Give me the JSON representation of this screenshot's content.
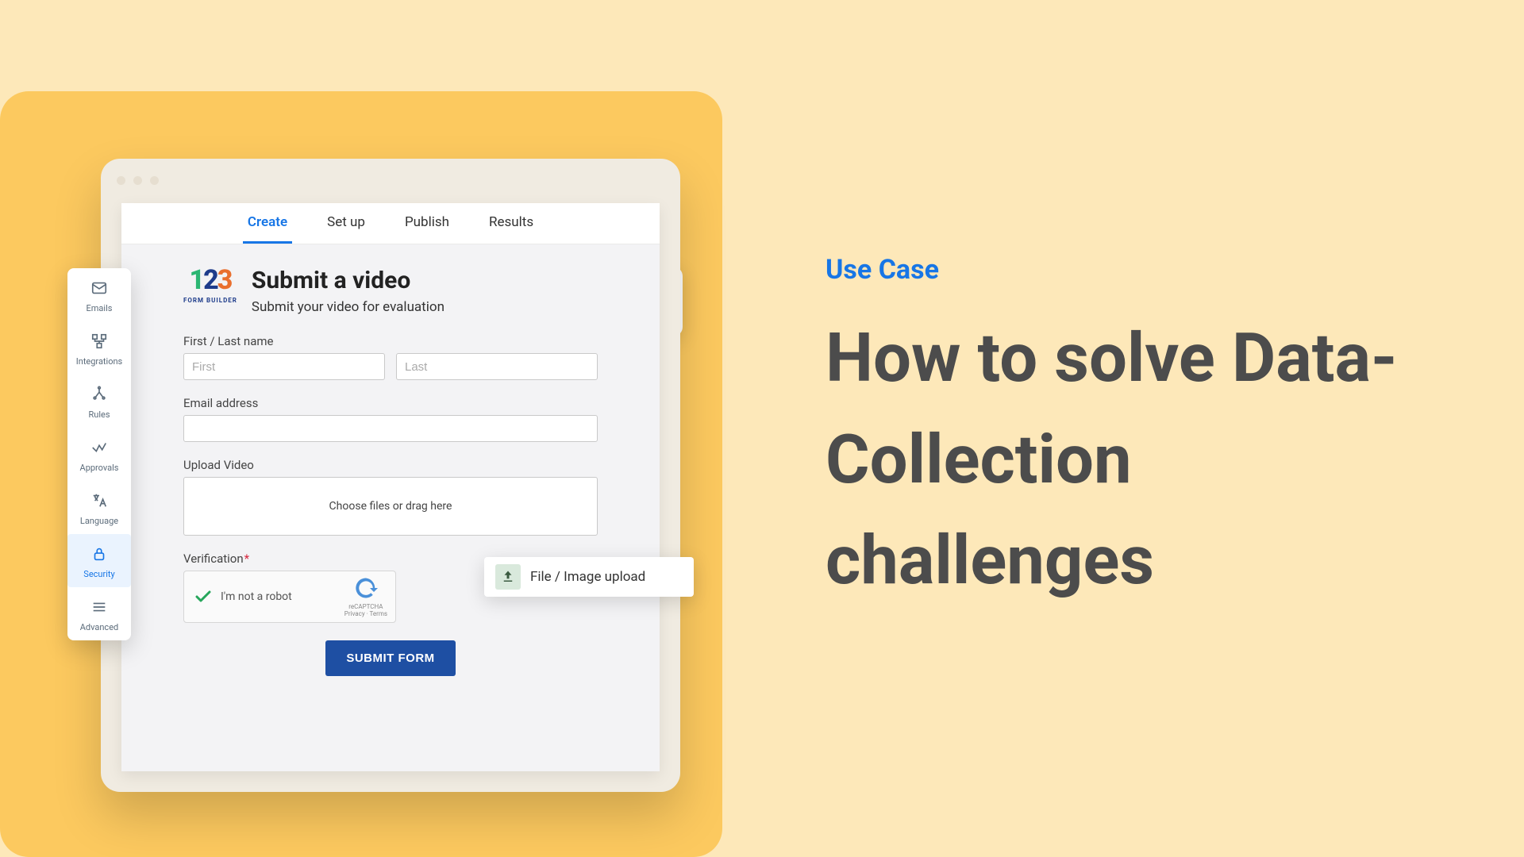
{
  "sidebar": {
    "items": [
      {
        "label": "Emails"
      },
      {
        "label": "Integrations"
      },
      {
        "label": "Rules"
      },
      {
        "label": "Approvals"
      },
      {
        "label": "Language"
      },
      {
        "label": "Security"
      },
      {
        "label": "Advanced"
      }
    ]
  },
  "tabs": [
    {
      "label": "Create",
      "active": true
    },
    {
      "label": "Set up",
      "active": false
    },
    {
      "label": "Publish",
      "active": false
    },
    {
      "label": "Results",
      "active": false
    }
  ],
  "brand": {
    "d1": "1",
    "d2": "2",
    "d3": "3",
    "sub": "FORM BUILDER"
  },
  "form": {
    "title": "Submit a video",
    "subtitle": "Submit your video for evaluation",
    "name_label": "First / Last name",
    "first_placeholder": "First",
    "last_placeholder": "Last",
    "email_label": "Email address",
    "upload_label": "Upload Video",
    "dropzone_text": "Choose files or drag here",
    "verification_label": "Verification",
    "not_robot": "I'm not a robot",
    "recaptcha_name": "reCAPTCHA",
    "recaptcha_links": "Privacy · Terms",
    "submit": "SUBMIT FORM"
  },
  "file_pill": {
    "label": "File / Image upload"
  },
  "right": {
    "eyebrow": "Use Case",
    "headline": "How to solve Data-Collection challenges"
  }
}
